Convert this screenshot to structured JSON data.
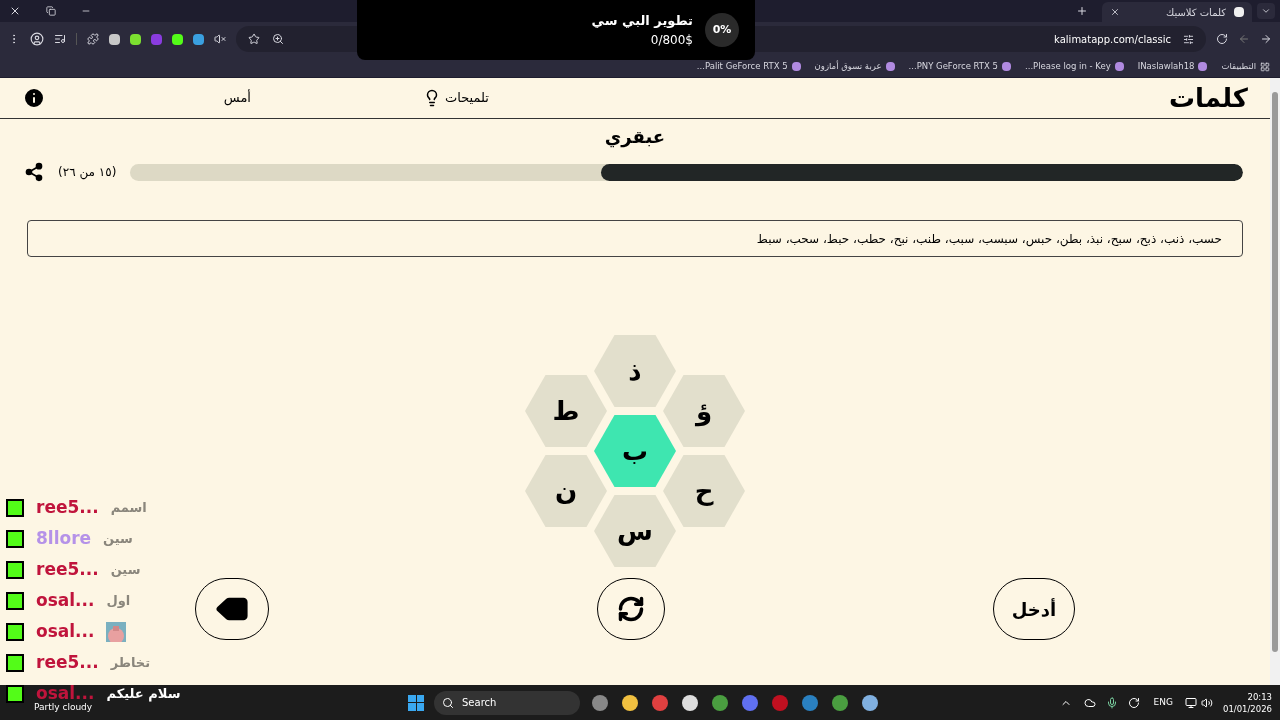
{
  "browser": {
    "tab": {
      "title": "كلمات كلاسيك",
      "selected": true
    },
    "url": "kalimatapp.com/classic",
    "bookmarks": [
      "التطبيقات",
      "INaslawlah18",
      "Please log in - Key...",
      "PNY GeForce RTX 5...",
      "عربة تسوق أمازون",
      "Palit GeForce RTX 5..."
    ]
  },
  "donation": {
    "title": "تطوير البي سي",
    "amount": "0/800$",
    "percent": "0%"
  },
  "app": {
    "logo": "كلمات",
    "hints": "تلميحات",
    "yesterday": "أمس",
    "rank": "عبقري",
    "progress_label": "(١٥ من ٢٦)",
    "level": 0.577,
    "found_words": "حسب، ذنب، ذبح، سبح، نبذ، بطن، حبس، سبسب، سبب، طنب، نبح، حطب، حبط، سحب، سبط",
    "center_letter": "ب",
    "outer_letters": [
      "ذ",
      "ؤ",
      "ح",
      "س",
      "ن",
      "ط"
    ],
    "enter": "أدخل"
  },
  "chat": [
    {
      "user": "ree5...",
      "color": "#c0143c",
      "kind": "text",
      "message": "اسمم"
    },
    {
      "user": "8llore",
      "color": "#b592e8",
      "kind": "text",
      "message": "سين"
    },
    {
      "user": "ree5...",
      "color": "#c0143c",
      "kind": "text",
      "message": "سين"
    },
    {
      "user": "osal...",
      "color": "#c0143c",
      "kind": "text",
      "message": "اول"
    },
    {
      "user": "osal...",
      "color": "#c0143c",
      "kind": "emote"
    },
    {
      "user": "ree5...",
      "color": "#c0143c",
      "kind": "text",
      "message": "تخاطر"
    },
    {
      "user": "osal...",
      "color": "#c0143c",
      "kind": "text",
      "message": "سلام عليكم"
    }
  ],
  "taskbar": {
    "weather": "Partly cloudy",
    "search": "Search",
    "language": "ENG",
    "time": "20:13",
    "date": "01/01/2026"
  }
}
